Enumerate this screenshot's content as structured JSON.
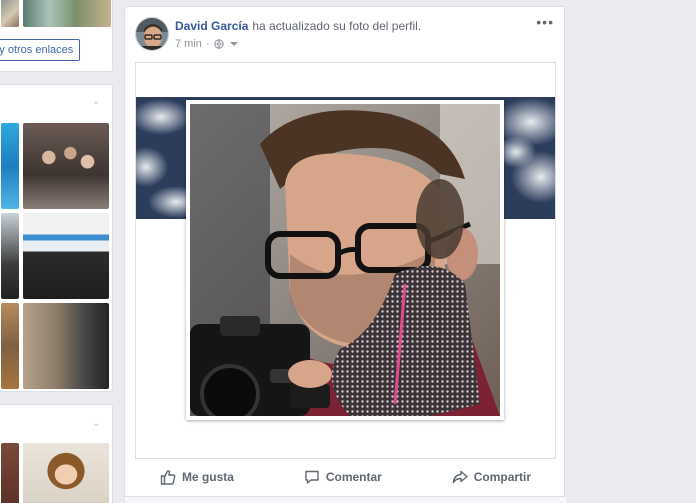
{
  "left": {
    "links_button": "eb y otros enlaces"
  },
  "post": {
    "author": "David García",
    "action": "ha actualizado su foto del perfil.",
    "time": "7 min",
    "privacy_icon": "globe-icon",
    "more_icon": "more-options-icon"
  },
  "actions": {
    "like": "Me gusta",
    "comment": "Comentar",
    "share": "Compartir"
  },
  "colors": {
    "link_blue": "#385898",
    "button_blue": "#4267b2",
    "action_gray": "#606770",
    "page_bg": "#e9ebee"
  }
}
